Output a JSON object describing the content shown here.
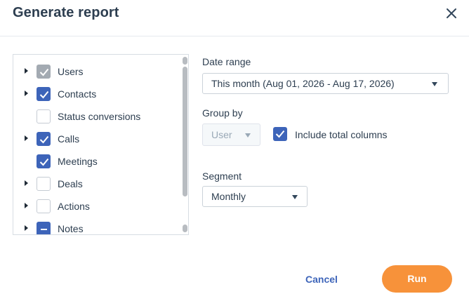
{
  "dialog": {
    "title": "Generate report",
    "close_icon": "close-icon"
  },
  "tree": {
    "items": [
      {
        "label": "Users",
        "state": "checked-disabled",
        "expandable": true
      },
      {
        "label": "Contacts",
        "state": "checked",
        "expandable": true
      },
      {
        "label": "Status conversions",
        "state": "unchecked",
        "expandable": false
      },
      {
        "label": "Calls",
        "state": "checked",
        "expandable": true
      },
      {
        "label": "Meetings",
        "state": "checked",
        "expandable": false
      },
      {
        "label": "Deals",
        "state": "unchecked",
        "expandable": true
      },
      {
        "label": "Actions",
        "state": "unchecked",
        "expandable": true
      },
      {
        "label": "Notes",
        "state": "indeterminate",
        "expandable": true
      }
    ]
  },
  "form": {
    "date_range": {
      "label": "Date range",
      "value": "This month (Aug 01, 2026 - Aug 17, 2026)"
    },
    "group_by": {
      "label": "Group by",
      "value": "User",
      "disabled": true
    },
    "include_total": {
      "label": "Include total columns",
      "checked": true
    },
    "segment": {
      "label": "Segment",
      "value": "Monthly"
    }
  },
  "actions": {
    "cancel_label": "Cancel",
    "run_label": "Run"
  },
  "colors": {
    "accent": "#3d64b9",
    "primary_button": "#f7923a",
    "text": "#2d3e50",
    "disabled_checkbox": "#a3aab2"
  }
}
